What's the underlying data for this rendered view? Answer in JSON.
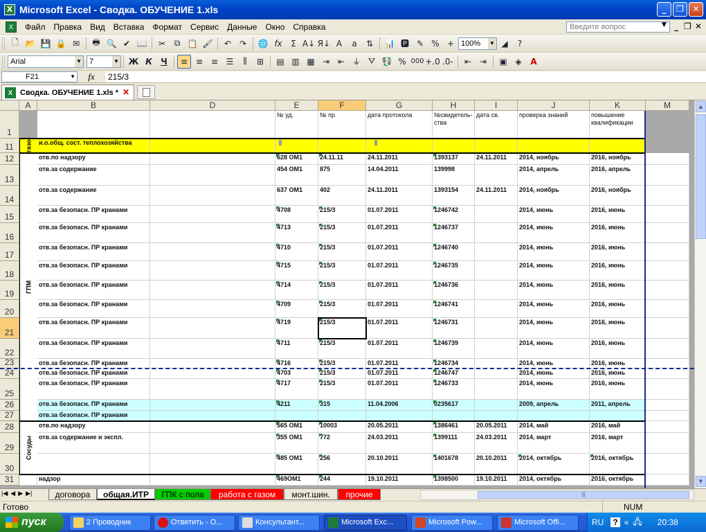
{
  "window": {
    "title": "Microsoft Excel - Сводка. ОБУЧЕНИЕ 1.xls"
  },
  "menu": [
    "Файл",
    "Правка",
    "Вид",
    "Вставка",
    "Формат",
    "Сервис",
    "Данные",
    "Окно",
    "Справка"
  ],
  "help_placeholder": "Введите вопрос",
  "toolbar": {
    "zoom": "100%",
    "font": "Arial",
    "size": "7",
    "bold": "Ж",
    "italic": "К",
    "underline": "Ч",
    "percent": "%",
    "thousands": "000"
  },
  "formula": {
    "cell": "F21",
    "fx": "fx",
    "value": "215/3"
  },
  "doc_tab": "Сводка. ОБУЧЕНИЕ 1.xls *",
  "columns": [
    "A",
    "B",
    "D",
    "E",
    "F",
    "G",
    "H",
    "I",
    "J",
    "K",
    "M"
  ],
  "headers": {
    "E": "№ уд.",
    "F": "№ пр",
    "G": "дата протокола",
    "H": "№свидетель-ства",
    "I": "дата св.",
    "J": "проверка знаний",
    "K": "повышение квалификации"
  },
  "groups": {
    "gaz": "газо",
    "gpm": "ГПМ",
    "sosudy": "Сосуды"
  },
  "rows": [
    {
      "n": "1",
      "b": "",
      "e": "",
      "f": "",
      "g": "",
      "h": "",
      "i": "",
      "j": "",
      "k": ""
    },
    {
      "n": "11",
      "b": "и.о.общ. сост. теплохозяйства",
      "e": "",
      "f": "",
      "g": "",
      "h": "",
      "i": "",
      "j": "",
      "k": ""
    },
    {
      "n": "12",
      "b": "отв.по надзору",
      "e": "628 ОМ1",
      "f": "24.11.11",
      "g": "24.11.2011",
      "h": "1393137",
      "i": "24.11.2011",
      "j": "2014, ноябрь",
      "k": "2016, ноябрь"
    },
    {
      "n": "13",
      "b": "отв.за содержание",
      "e": "454 ОМ1",
      "f": "875",
      "g": "14.04.2011",
      "h": "139998",
      "i": "",
      "j": "2014, апрель",
      "k": "2016, апрель"
    },
    {
      "n": "14",
      "b": "отв.за содержание",
      "e": "637 ОМ1",
      "f": "402",
      "g": "24.11.2011",
      "h": "1393154",
      "i": "24.11.2011",
      "j": "2014, ноябрь",
      "k": "2016, ноябрь"
    },
    {
      "n": "15",
      "b": "отв.за безопасн. ПР кранами",
      "e": "4708",
      "f": "215/3",
      "g": "01.07.2011",
      "h": "1246742",
      "i": "",
      "j": "2014, июнь",
      "k": "2016, июнь"
    },
    {
      "n": "16",
      "b": "отв.за безопасн. ПР кранами",
      "e": "4713",
      "f": "215/3",
      "g": "01.07.2011",
      "h": "1246737",
      "i": "",
      "j": "2014, июнь",
      "k": "2016, июнь"
    },
    {
      "n": "17",
      "b": "отв.за безопасн. ПР кранами",
      "e": "4710",
      "f": "215/3",
      "g": "01.07.2011",
      "h": "1246740",
      "i": "",
      "j": "2014, июнь",
      "k": "2016, июнь"
    },
    {
      "n": "18",
      "b": "отв.за безопасн. ПР кранами",
      "e": "4715",
      "f": "215/3",
      "g": "01.07.2011",
      "h": "1246735",
      "i": "",
      "j": "2014, июнь",
      "k": "2016, июнь"
    },
    {
      "n": "19",
      "b": "отв.за безопасн. ПР кранами",
      "e": "4714",
      "f": "215/3",
      "g": "01.07.2011",
      "h": "1246736",
      "i": "",
      "j": "2014, июнь",
      "k": "2016, июнь"
    },
    {
      "n": "20",
      "b": "отв.за безопасн. ПР кранами",
      "e": "4709",
      "f": "215/3",
      "g": "01.07.2011",
      "h": "1246741",
      "i": "",
      "j": "2014, июнь",
      "k": "2016, июнь"
    },
    {
      "n": "21",
      "b": "отв.за безопасн. ПР кранами",
      "e": "4719",
      "f": "215/3",
      "g": "01.07.2011",
      "h": "1246731",
      "i": "",
      "j": "2014, июнь",
      "k": "2016, июнь"
    },
    {
      "n": "22",
      "b": "отв.за безопасн. ПР кранами",
      "e": "4711",
      "f": "215/3",
      "g": "01.07.2011",
      "h": "1246739",
      "i": "",
      "j": "2014, июнь",
      "k": "2016, июнь"
    },
    {
      "n": "23",
      "b": "отв.за безопасн. ПР кранами",
      "e": "4716",
      "f": "215/3",
      "g": "01.07.2011",
      "h": "1246734",
      "i": "",
      "j": "2014, июнь",
      "k": "2016, июнь"
    },
    {
      "n": "24",
      "b": "отв.за безопасн. ПР кранами",
      "e": "4703",
      "f": "215/3",
      "g": "01.07.2011",
      "h": "1246747",
      "i": "",
      "j": "2014, июнь",
      "k": "2016, июнь"
    },
    {
      "n": "25",
      "b": "отв.за безопасн. ПР кранами",
      "e": "4717",
      "f": "215/3",
      "g": "01.07.2011",
      "h": "1246733",
      "i": "",
      "j": "2014, июнь",
      "k": "2016, июнь"
    },
    {
      "n": "26",
      "b": "отв.за безопасн. ПР кранами",
      "e": "4211",
      "f": "315",
      "g": "11.04.2006",
      "h": "0235617",
      "i": "",
      "j": "2009, апрель",
      "k": "2011, апрель"
    },
    {
      "n": "27",
      "b": "отв.за безопасн. ПР кранами",
      "e": "",
      "f": "",
      "g": "",
      "h": "",
      "i": "",
      "j": "",
      "k": ""
    },
    {
      "n": "28",
      "b": "отв.по надзору",
      "e": "565 ОМ1",
      "f": "10003",
      "g": "20.05.2011",
      "h": "1386461",
      "i": "20.05.2011",
      "j": "2014, май",
      "k": "2016, май"
    },
    {
      "n": "29",
      "b": "отв.за содержание и экспл.",
      "e": "355 ОМ1",
      "f": "772",
      "g": "24.03.2011",
      "h": "1399111",
      "i": "24.03.2011",
      "j": "2014, март",
      "k": "2016, март"
    },
    {
      "n": "30",
      "b": "",
      "e": "485 ОМ1",
      "f": "256",
      "g": "20.10.2011",
      "h": "1401678",
      "i": "20.10.2011",
      "j": "2014, октябрь",
      "k": "2016, октябрь"
    },
    {
      "n": "31",
      "b": "надзор",
      "e": "469ОМ1",
      "f": "244",
      "g": "19.10.2011",
      "h": "1398500",
      "i": "19.10.2011",
      "j": "2014, октябрь",
      "k": "2016, октябрь"
    }
  ],
  "sheet_tabs": [
    "договора",
    "общая.ИТР",
    "ГПК с пола",
    "работа с газом",
    "монт.шин.",
    "прочие"
  ],
  "status": {
    "ready": "Готово",
    "num": "NUM"
  },
  "taskbar": {
    "start": "пуск",
    "tasks": [
      "2 Проводник",
      "Ответить - О...",
      "Консультант...",
      "Microsoft Exc...",
      "Microsoft Pow...",
      "Microsoft Offi..."
    ],
    "lang": "RU",
    "clock": "20:38"
  }
}
